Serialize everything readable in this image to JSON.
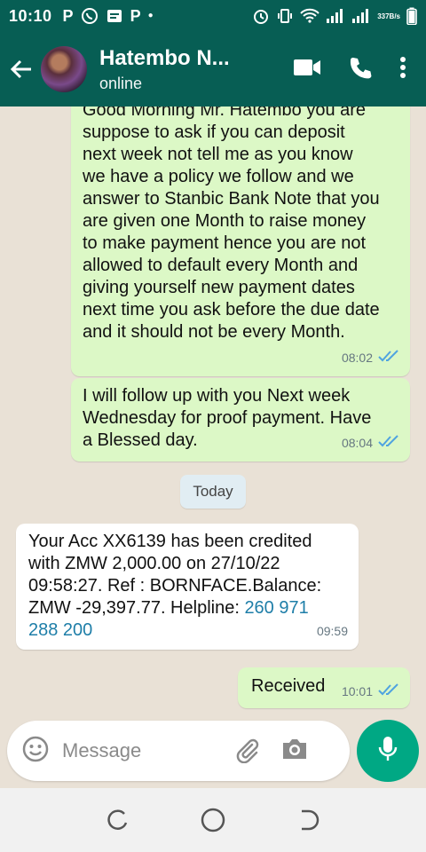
{
  "status_bar": {
    "time": "10:10",
    "network_speed_value": "337",
    "network_speed_unit": "B/s",
    "notification_icons": [
      "p-app-icon",
      "whatsapp-icon",
      "message-icon",
      "p-app-icon",
      "dot-icon"
    ],
    "system_icons": [
      "alarm-icon",
      "vibrate-icon",
      "wifi-icon",
      "signal-icon",
      "signal-icon",
      "battery-icon"
    ]
  },
  "header": {
    "contact_name": "Hatembo N...",
    "contact_status": "online",
    "actions": [
      "video-call-icon",
      "voice-call-icon",
      "more-icon"
    ]
  },
  "messages": [
    {
      "direction": "outgoing",
      "text": "Good Morning Mr. Hatembo you are\nsuppose to ask if you can deposit\nnext week not tell me as you know\nwe have a policy we follow and we\nanswer to Stanbic Bank Note that you\nare given one Month to raise money\nto make payment hence you are not\nallowed to default every Month and\ngiving yourself new payment dates\nnext time you ask before the due date\nand it should not be every Month.",
      "time": "08:02",
      "status": "read"
    },
    {
      "direction": "outgoing",
      "text": "I will follow up with you Next week\nWednesday for proof payment.  Have\na Blessed day.",
      "time": "08:04",
      "status": "read"
    },
    {
      "direction": "incoming",
      "text_before_link": "Your Acc XX6139 has been credited\nwith ZMW 2,000.00 on 27/10/22\n09:58:27. Ref : BORNFACE.Balance:\nZMW -29,397.77. Helpline: ",
      "link_text": "260 971\n288 200",
      "time": "09:59"
    },
    {
      "direction": "outgoing",
      "text": "Received",
      "time": "10:01",
      "status": "read"
    }
  ],
  "date_divider": "Today",
  "composer": {
    "placeholder": "Message",
    "icons": [
      "emoji-icon",
      "attach-icon",
      "camera-icon",
      "mic-icon"
    ]
  },
  "nav_bar": {
    "buttons": [
      "recents-icon",
      "home-icon",
      "back-icon"
    ]
  },
  "colors": {
    "header": "#075e54",
    "outgoing_bubble": "#dcf8c6",
    "incoming_bubble": "#ffffff",
    "chat_background": "#e9e1d6",
    "accent": "#00a884",
    "read_ticks": "#4fa3e0",
    "link": "#1e7ea8"
  }
}
